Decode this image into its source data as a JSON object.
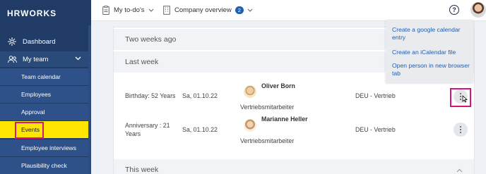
{
  "sidebar": {
    "logo": "HRWORKS",
    "items": [
      {
        "label": "Dashboard",
        "icon": "dashboard-icon"
      },
      {
        "label": "My team",
        "icon": "team-icon"
      }
    ],
    "subitems": [
      {
        "label": "Team calendar"
      },
      {
        "label": "Employees"
      },
      {
        "label": "Approval"
      },
      {
        "label": "Events",
        "active": true
      },
      {
        "label": "Employee interviews"
      },
      {
        "label": "Plausibility check"
      }
    ]
  },
  "topbar": {
    "todo_label": "My to-do's",
    "company_label": "Company overview",
    "company_badge": "2",
    "help_label": "?"
  },
  "main": {
    "sections": [
      {
        "label": "Two weeks ago"
      },
      {
        "label": "Last week"
      },
      {
        "label": "This week"
      }
    ],
    "rows": [
      {
        "event": "Birthday: 52 Years",
        "date": "Sa, 01.10.22",
        "name": "Oliver Born",
        "role": "Vertriebsmitarbeiter",
        "department": "DEU - Vertrieb"
      },
      {
        "event": "Anniversary : 21 Years",
        "date": "Sa, 01.10.22",
        "name": "Marianne Heller",
        "role": "Vertriebsmitarbeiter",
        "department": "DEU - Vertrieb"
      }
    ]
  },
  "menu": {
    "items": [
      {
        "label": "Create a google calendar entry"
      },
      {
        "label": "Create an iCalendar file"
      },
      {
        "label": "Open person in new browser tab"
      }
    ]
  },
  "colors": {
    "sidebar_bg": "#1f3b66",
    "active_item": "#ffe600",
    "highlight": "#d5157e",
    "link": "#1e5fb4"
  }
}
